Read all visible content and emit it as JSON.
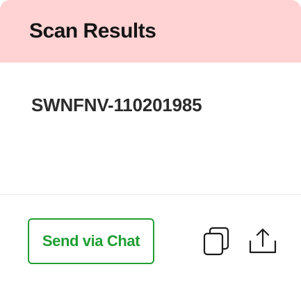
{
  "header": {
    "title": "Scan Results"
  },
  "result": {
    "value": "SWNFNV-110201985"
  },
  "actions": {
    "send_label": "Send via Chat",
    "copy_icon": "copy-icon",
    "share_icon": "share-icon"
  },
  "colors": {
    "header_bg": "#ffd3d3",
    "accent_green": "#1f9e33",
    "text_dark": "#151515"
  }
}
